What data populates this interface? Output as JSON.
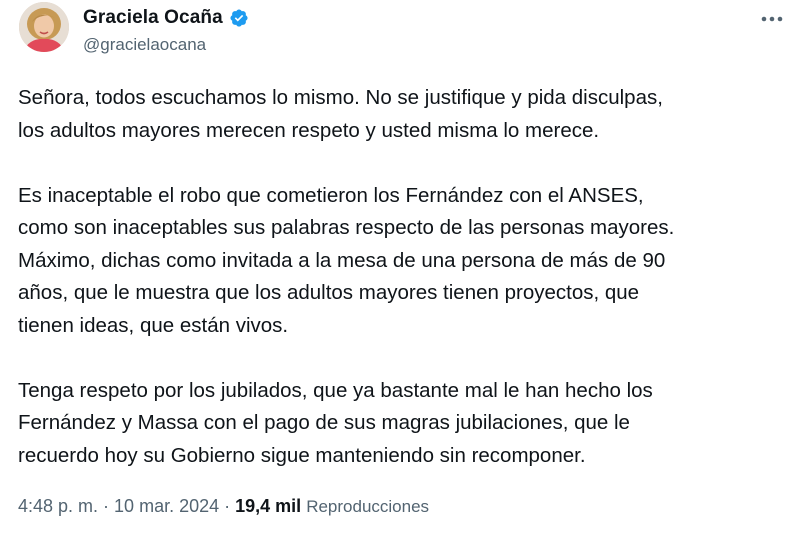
{
  "author": {
    "display_name": "Graciela Ocaña",
    "handle": "@gracielaocana",
    "verified": true,
    "verified_color": "#1d9bf0"
  },
  "menu": {
    "icon": "more-horizontal-icon"
  },
  "tweet": {
    "paragraphs": [
      {
        "lines": [
          "Señora, todos escuchamos lo mismo. No se justifique y pida disculpas,",
          "los adultos mayores merecen respeto y usted misma lo merece."
        ]
      },
      {
        "lines": [
          "Es inaceptable el robo que cometieron los Fernández con el ANSES,",
          "como son inaceptables sus palabras respecto de las personas mayores.",
          "Máximo, dichas como invitada a la mesa de una persona de más de 90",
          "años, que le muestra que los adultos mayores tienen proyectos, que",
          "tienen ideas, que están vivos."
        ]
      },
      {
        "lines": [
          "Tenga respeto por los jubilados, que ya bastante mal le han hecho los",
          "Fernández y Massa con el pago de sus magras jubilaciones, que le",
          "recuerdo hoy su Gobierno sigue manteniendo sin recomponer."
        ]
      }
    ]
  },
  "meta": {
    "time": "4:48 p. m.",
    "separator": " · ",
    "date": "10 mar. 2024",
    "views_count": "19,4 mil",
    "views_label": "Reproducciones"
  },
  "colors": {
    "text": "#0f1419",
    "secondary": "#536471",
    "accent": "#1d9bf0"
  }
}
